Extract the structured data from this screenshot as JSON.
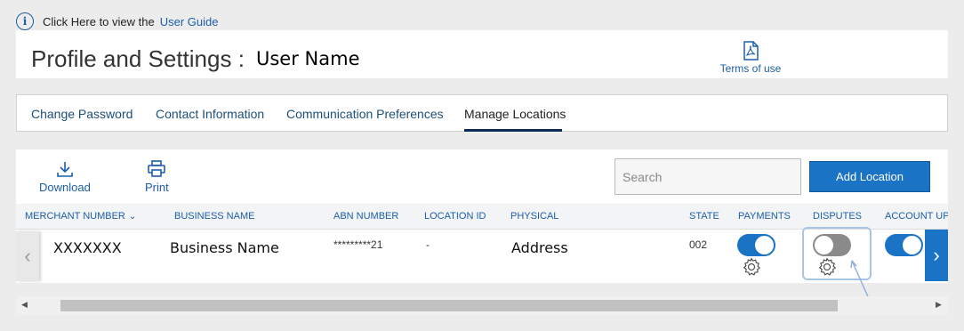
{
  "info": {
    "prefix": "Click Here to view the",
    "link": "User Guide",
    "icon": "info-icon"
  },
  "header": {
    "title": "Profile and Settings :",
    "user_name": "User Name",
    "terms_label": "Terms of use",
    "terms_icon": "pdf-icon"
  },
  "tabs": [
    {
      "label": "Change Password"
    },
    {
      "label": "Contact Information"
    },
    {
      "label": "Communication Preferences"
    },
    {
      "label": "Manage Locations"
    }
  ],
  "active_tab": "Manage Locations",
  "toolbar": {
    "download_label": "Download",
    "print_label": "Print",
    "search_placeholder": "Search",
    "add_button": "Add Location"
  },
  "columns": [
    "MERCHANT NUMBER",
    "BUSINESS NAME",
    "ABN NUMBER",
    "LOCATION ID",
    "PHYSICAL",
    "STATE",
    "PAYMENTS",
    "DISPUTES",
    "ACCOUNT UP"
  ],
  "row": {
    "merchant_number": "XXXXXXX",
    "business_name": "Business Name",
    "abn_number": "*********21",
    "location_id": "-",
    "physical": "Address",
    "state": "002",
    "payments": "on",
    "disputes": "off",
    "account_updates": "on"
  },
  "colors": {
    "accent": "#1a73c4",
    "link": "#1d5ea8",
    "toggle_off": "#8a8a8a"
  }
}
